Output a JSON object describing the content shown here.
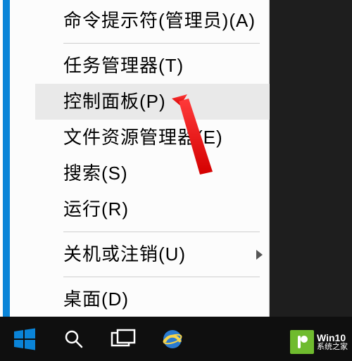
{
  "menu": {
    "items": [
      {
        "label": "命令提示符(管理员)(A)",
        "highlighted": false,
        "submenu": false
      },
      {
        "label": "任务管理器(T)",
        "highlighted": false,
        "submenu": false
      },
      {
        "label": "控制面板(P)",
        "highlighted": true,
        "submenu": false
      },
      {
        "label": "文件资源管理器(E)",
        "highlighted": false,
        "submenu": false
      },
      {
        "label": "搜索(S)",
        "highlighted": false,
        "submenu": false
      },
      {
        "label": "运行(R)",
        "highlighted": false,
        "submenu": false
      },
      {
        "label": "关机或注销(U)",
        "highlighted": false,
        "submenu": true
      },
      {
        "label": "桌面(D)",
        "highlighted": false,
        "submenu": false
      }
    ]
  },
  "taskbar": {
    "buttons": [
      "start",
      "search",
      "task-view",
      "ie"
    ]
  },
  "watermark": {
    "brand": "Win10",
    "sub": "系统之家"
  },
  "annotation": {
    "arrow_color": "#ff1e1e"
  }
}
